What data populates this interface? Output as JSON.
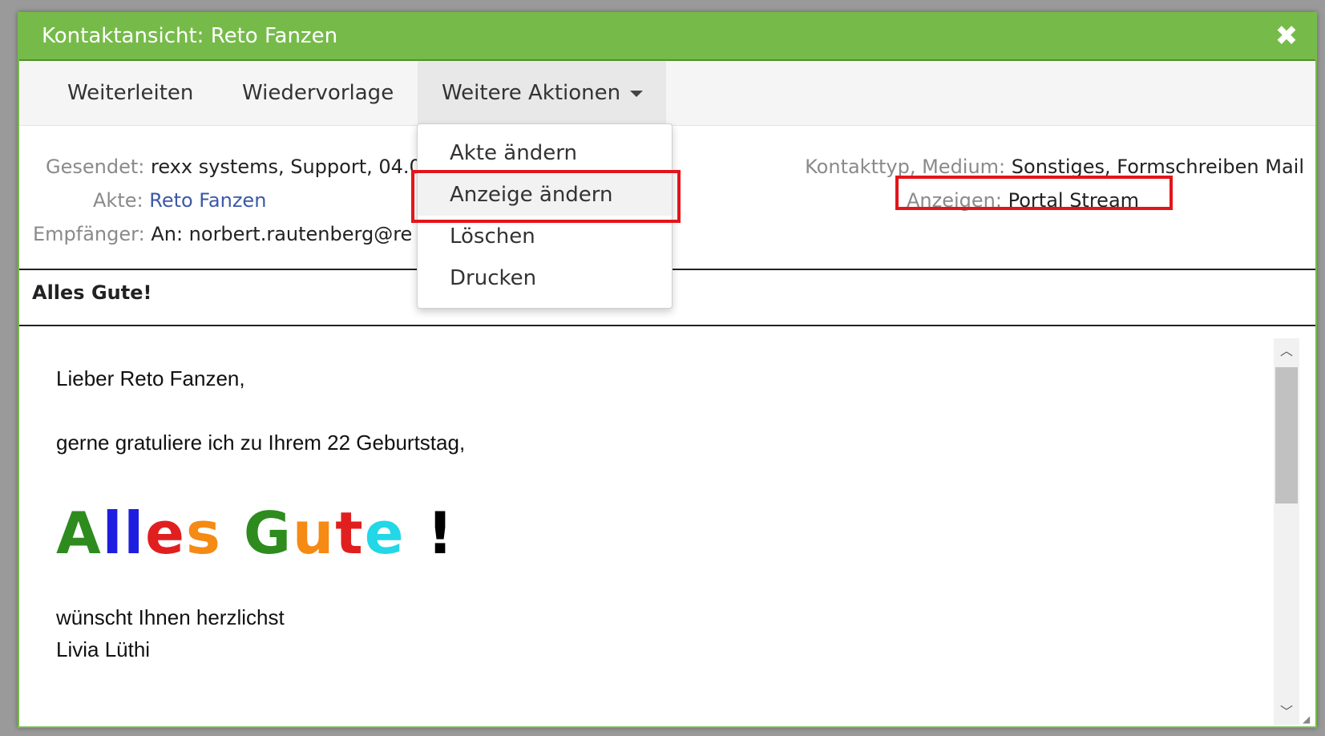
{
  "window": {
    "title": "Kontaktansicht: Reto Fanzen",
    "close_label": "✖"
  },
  "toolbar": {
    "forward_label": "Weiterleiten",
    "followup_label": "Wiedervorlage",
    "more_actions_label": "Weitere Aktionen"
  },
  "dropdown": {
    "items": [
      "Akte ändern",
      "Anzeige ändern",
      "Löschen",
      "Drucken"
    ],
    "highlighted_index": 1
  },
  "meta": {
    "sent_label": "Gesendet:",
    "sent_value": "rexx systems, Support, 04.0",
    "file_label": "Akte:",
    "file_value": "Reto Fanzen",
    "recipient_label": "Empfänger:",
    "recipient_value": "An: norbert.rautenberg@re",
    "contact_type_label": "Kontakttyp, Medium:",
    "contact_type_value": "Sonstiges, Formschreiben Mail",
    "display_label": "Anzeigen:",
    "display_value": "Portal Stream"
  },
  "message": {
    "subject": "Alles Gute!",
    "greeting": "Lieber Reto Fanzen,",
    "line1": "gerne gratuliere ich zu Ihrem 22 Geburtstag,",
    "banner_letters": [
      {
        "ch": "A",
        "color": "#2e8b1e"
      },
      {
        "ch": "l",
        "color": "#1e1ee0"
      },
      {
        "ch": "l",
        "color": "#1e1ee0"
      },
      {
        "ch": "e",
        "color": "#e11f1f"
      },
      {
        "ch": "s",
        "color": "#f58a14"
      },
      {
        "ch": " ",
        "color": "#000000"
      },
      {
        "ch": "G",
        "color": "#2e8b1e"
      },
      {
        "ch": "u",
        "color": "#f58a14"
      },
      {
        "ch": "t",
        "color": "#e11f1f"
      },
      {
        "ch": "e",
        "color": "#22d7e6"
      },
      {
        "ch": " ",
        "color": "#000000"
      },
      {
        "ch": "!",
        "color": "#000000"
      }
    ],
    "closing": "wünscht Ihnen herzlichst",
    "signature": "Livia Lüthi"
  },
  "colors": {
    "header_green": "#76bb4a",
    "highlight_red": "#e3151a",
    "link_blue": "#3c58a8"
  },
  "icons": {
    "close": "close-icon",
    "caret": "caret-down-icon",
    "scroll_up": "chevron-up-icon",
    "scroll_down": "chevron-down-icon"
  }
}
